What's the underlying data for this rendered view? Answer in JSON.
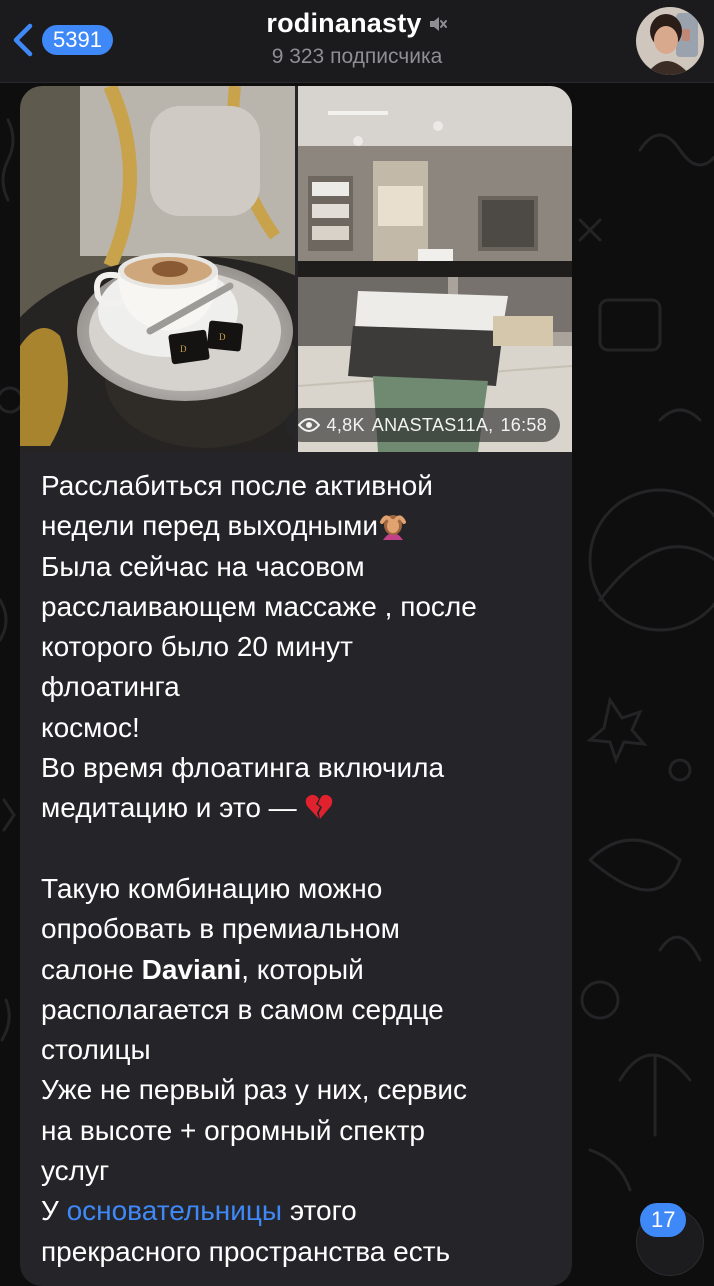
{
  "header": {
    "back_badge": "5391",
    "channel_name": "rodinanasty",
    "subscribers": "9 323 подписчика",
    "muted": true
  },
  "post": {
    "views": "4,8K",
    "author": "ANASTAS11A,",
    "time": "16:58",
    "lines": {
      "l1": "Расслабиться после активной",
      "l2": "недели перед выходными",
      "l3": "Была сейчас на часовом",
      "l4": "расслаивающем массаже , после",
      "l5": "которого было 20 минут",
      "l6": "флоатинга",
      "l7": "космос!",
      "l8": "Во время флоатинга включила",
      "l9": "медитацию и это —",
      "l10": "Такую комбинацию можно",
      "l11": "опробовать в премиальном",
      "l12_pre": "салоне ",
      "l12_bold": "Daviani",
      "l12_post": ", который",
      "l13": "располагается в самом сердце",
      "l14": "столицы",
      "l15": "Уже не первый раз у них, сервис",
      "l16": "на высоте + огромный спектр",
      "l17": "услуг",
      "l18_pre": "У ",
      "l18_link": "основательницы",
      "l18_post": " этого",
      "l19": "прекрасного пространства есть"
    },
    "emojis": [
      "woman-getting-massage-icon",
      "broken-heart-icon"
    ]
  },
  "scroll_badge": "17",
  "colors": {
    "accent": "#3e88f7",
    "bubble": "#252428",
    "header": "#1c1c1e",
    "muted_text": "#8e8e93"
  }
}
